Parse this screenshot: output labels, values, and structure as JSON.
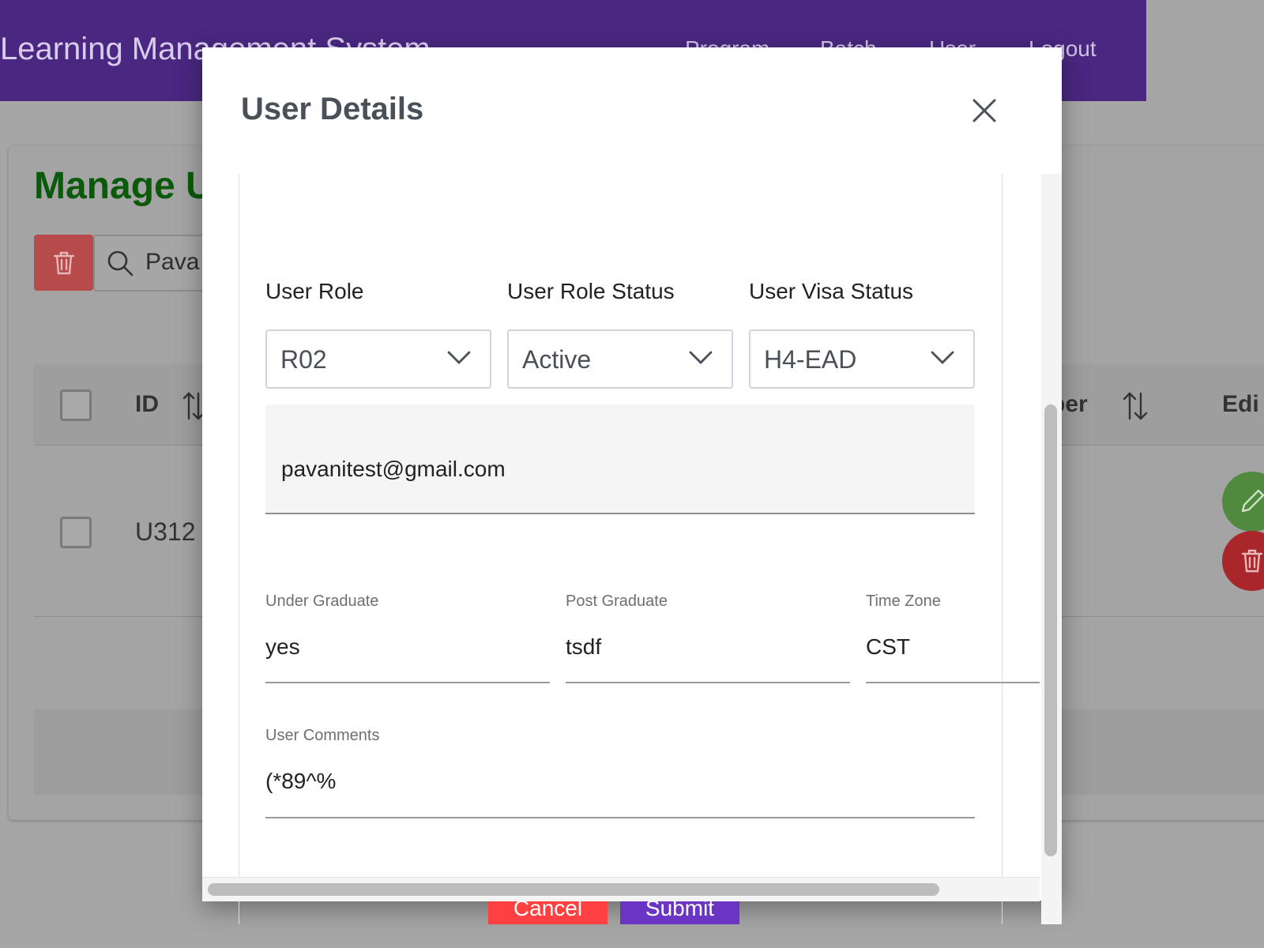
{
  "app": {
    "title": "Learning Management System",
    "nav": [
      "Program",
      "Batch",
      "User",
      "Logout"
    ]
  },
  "background": {
    "page_title": "Manage U",
    "search_value": "Pava",
    "table_headers": {
      "id": "ID",
      "number_fragment": "ber",
      "edit_fragment": "Edi"
    },
    "row_id": "U312"
  },
  "modal": {
    "title": "User Details",
    "fields": {
      "user_role": {
        "label": "User Role",
        "value": "R02"
      },
      "user_role_status": {
        "label": "User Role Status",
        "value": "Active"
      },
      "user_visa_status": {
        "label": "User Visa Status",
        "value": "H4-EAD"
      },
      "email": {
        "value": "pavanitest@gmail.com"
      },
      "under_graduate": {
        "label": "Under Graduate",
        "value": "yes"
      },
      "post_graduate": {
        "label": "Post Graduate",
        "value": "tsdf"
      },
      "time_zone": {
        "label": "Time Zone",
        "value": "CST"
      },
      "user_comments": {
        "label": "User Comments",
        "value": "(*89^%"
      }
    },
    "buttons": {
      "cancel": "Cancel",
      "submit": "Submit"
    }
  },
  "colors": {
    "header_bg": "#4a2780",
    "cancel": "#ff4040",
    "submit": "#6a35c2",
    "manage_title": "#0b5a0b",
    "edit_btn": "#4f8a3f",
    "delete_btn": "#a9262b"
  }
}
